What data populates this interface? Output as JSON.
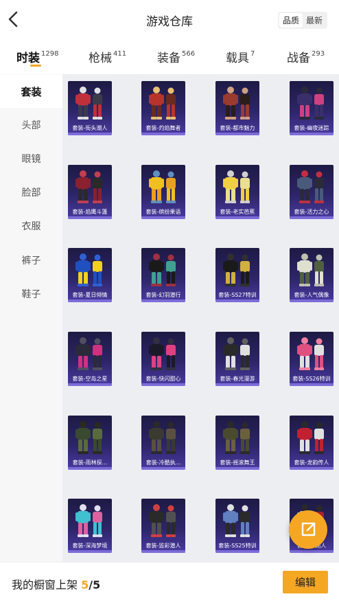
{
  "header": {
    "title": "游戏仓库",
    "back_icon": "chevron-left-icon",
    "sort_options": [
      "品质",
      "最新"
    ],
    "sort_selected": "品质"
  },
  "tabs": [
    {
      "label": "时装",
      "count": "1298",
      "active": true
    },
    {
      "label": "枪械",
      "count": "411",
      "active": false
    },
    {
      "label": "装备",
      "count": "566",
      "active": false
    },
    {
      "label": "载具",
      "count": "7",
      "active": false
    },
    {
      "label": "战备",
      "count": "293",
      "active": false
    }
  ],
  "sidebar": {
    "items": [
      {
        "label": "套装",
        "active": true
      },
      {
        "label": "头部",
        "active": false
      },
      {
        "label": "眼镜",
        "active": false
      },
      {
        "label": "脸部",
        "active": false
      },
      {
        "label": "衣服",
        "active": false
      },
      {
        "label": "裤子",
        "active": false
      },
      {
        "label": "鞋子",
        "active": false
      }
    ]
  },
  "items": [
    {
      "label": "套装-街头潮人",
      "palette": [
        "#c0303b",
        "#3b3b4a",
        "#e0e0e0"
      ]
    },
    {
      "label": "套装-灼焰舞者",
      "palette": [
        "#b8342a",
        "#6a2a20",
        "#e8c070"
      ]
    },
    {
      "label": "套装-都市魅力",
      "palette": [
        "#9a3b2f",
        "#2a1d1a",
        "#d0a080"
      ]
    },
    {
      "label": "套装-幽夜迷踪",
      "palette": [
        "#3a2f6a",
        "#d04080",
        "#2a2a3a"
      ]
    },
    {
      "label": "套装-焰鹰斗篷",
      "palette": [
        "#8a2030",
        "#2a2a2a",
        "#c04050"
      ]
    },
    {
      "label": "套装-缤纷果语",
      "palette": [
        "#f0c020",
        "#e8a020",
        "#6090c0"
      ]
    },
    {
      "label": "套装-老实芭蕉",
      "palette": [
        "#f0d040",
        "#e8e090",
        "#d0d0d0"
      ]
    },
    {
      "label": "套装-活力之心",
      "palette": [
        "#4a5a7a",
        "#2a2a3a",
        "#c03040"
      ]
    },
    {
      "label": "套装-夏日倾情",
      "palette": [
        "#2050c0",
        "#f0d020",
        "#3060d0"
      ]
    },
    {
      "label": "套装-幻羽潜行",
      "palette": [
        "#1a1a1a",
        "#40a090",
        "#a03040"
      ]
    },
    {
      "label": "套装-SS27特训",
      "palette": [
        "#1a1a1a",
        "#d0b040",
        "#303030"
      ]
    },
    {
      "label": "套装-人气偶像",
      "palette": [
        "#e0e0d0",
        "#506040",
        "#c0c0b0"
      ]
    },
    {
      "label": "套装-空岛之星",
      "palette": [
        "#2a2a3a",
        "#d03080",
        "#505060"
      ]
    },
    {
      "label": "套装-快闪甜心",
      "palette": [
        "#1a1a2a",
        "#e04080",
        "#303040"
      ]
    },
    {
      "label": "套装-春光漫游",
      "palette": [
        "#2a2a2a",
        "#e0e0e0",
        "#606060"
      ]
    },
    {
      "label": "套装-SS26特训",
      "palette": [
        "#e05080",
        "#e0e0e0",
        "#f080a0"
      ]
    },
    {
      "label": "套装-雨林探...",
      "palette": [
        "#3a4a30",
        "#5a6a40",
        "#2a2a20"
      ]
    },
    {
      "label": "套装-冷酷执...",
      "palette": [
        "#3a3a30",
        "#5a5040",
        "#2a2a2a"
      ]
    },
    {
      "label": "套装-摇滚舞王",
      "palette": [
        "#4a4a30",
        "#6a6040",
        "#2a2a2a"
      ]
    },
    {
      "label": "套装-龙韵传人",
      "palette": [
        "#c02030",
        "#e0e0e0",
        "#2a2a2a"
      ]
    },
    {
      "label": "套装-深海梦境",
      "palette": [
        "#40c0d0",
        "#e060a0",
        "#e0e0f0"
      ]
    },
    {
      "label": "套装-监彩潜人",
      "palette": [
        "#2a2a2a",
        "#505050",
        "#d04040"
      ]
    },
    {
      "label": "套装-SS25特训",
      "palette": [
        "#6080c0",
        "#2a2a2a",
        "#e0e0e0"
      ]
    },
    {
      "label": "套装-...湖人",
      "palette": [
        "#d0d0d0",
        "#b02030",
        "#2a2a2a"
      ]
    }
  ],
  "fab": {
    "icon": "share-icon"
  },
  "bottom_bar": {
    "label": "我的橱窗上架",
    "current": "5",
    "separator": "/",
    "total": "5",
    "edit_label": "编辑"
  },
  "colors": {
    "accent": "#f5a623",
    "card_bg": "#2c2568",
    "card_bottom": "#7d6bd8"
  }
}
